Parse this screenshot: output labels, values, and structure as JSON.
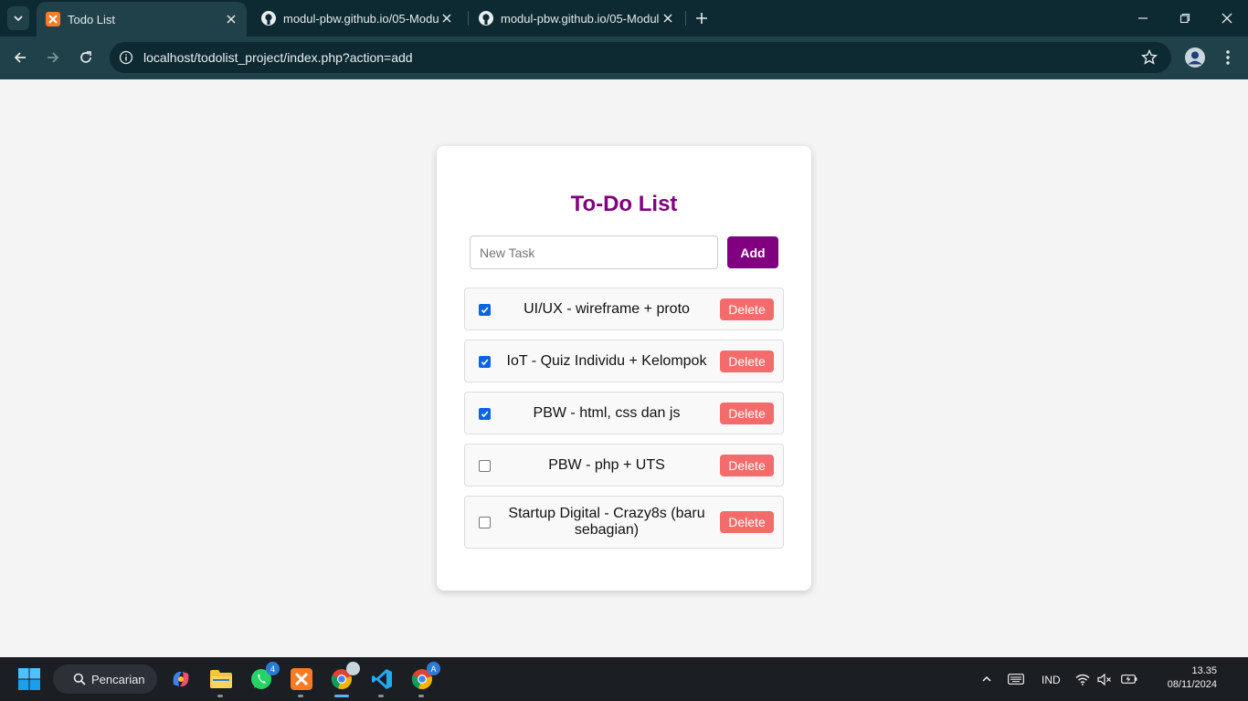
{
  "browser": {
    "tabs": [
      {
        "title": "Todo List",
        "active": true,
        "icon": "xampp-icon"
      },
      {
        "title": "modul-pbw.github.io/05-Modul",
        "active": false,
        "icon": "github-icon"
      },
      {
        "title": "modul-pbw.github.io/05-Modul",
        "active": false,
        "icon": "github-icon"
      }
    ],
    "url": "localhost/todolist_project/index.php?action=add"
  },
  "app": {
    "title": "To-Do List",
    "input_placeholder": "New Task",
    "add_label": "Add",
    "delete_label": "Delete",
    "accent_color": "#800080",
    "delete_color": "#f46b6b",
    "tasks": [
      {
        "text": "UI/UX - wireframe + proto",
        "done": true
      },
      {
        "text": "IoT - Quiz Individu + Kelompok",
        "done": true
      },
      {
        "text": "PBW - html, css dan js",
        "done": true
      },
      {
        "text": "PBW - php + UTS",
        "done": false
      },
      {
        "text": "Startup Digital - Crazy8s (baru sebagian)",
        "done": false
      }
    ]
  },
  "taskbar": {
    "search_label": "Pencarian",
    "whatsapp_badge": "4",
    "chrome_badge": "A",
    "language": "IND",
    "time": "13.35",
    "date": "08/11/2024"
  }
}
